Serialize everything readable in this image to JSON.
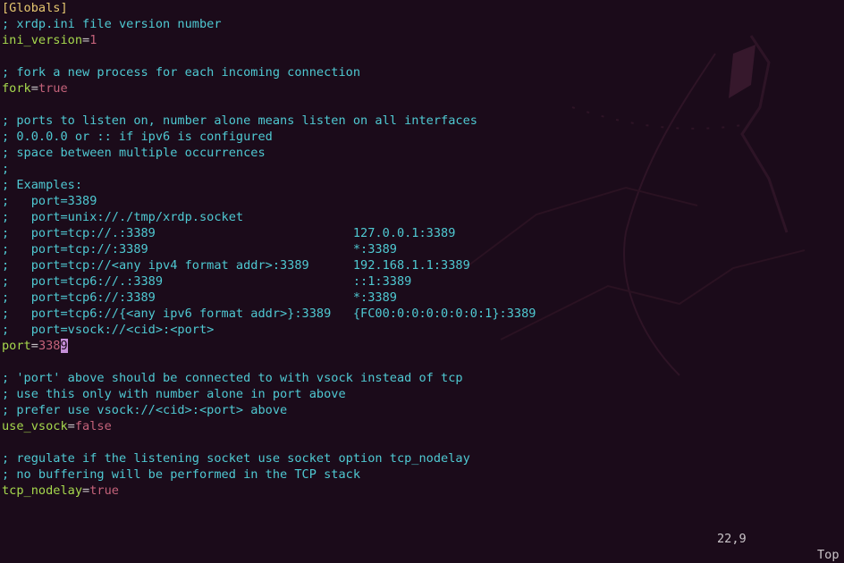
{
  "editor": {
    "lines": [
      {
        "t": "sec",
        "text": "[Globals]"
      },
      {
        "t": "cmt",
        "text": "; xrdp.ini file version number"
      },
      {
        "t": "kv",
        "key": "ini_version",
        "val": "1"
      },
      {
        "t": "blank",
        "text": ""
      },
      {
        "t": "cmt",
        "text": "; fork a new process for each incoming connection"
      },
      {
        "t": "kv",
        "key": "fork",
        "val": "true"
      },
      {
        "t": "blank",
        "text": ""
      },
      {
        "t": "cmt",
        "text": "; ports to listen on, number alone means listen on all interfaces"
      },
      {
        "t": "cmt",
        "text": "; 0.0.0.0 or :: if ipv6 is configured"
      },
      {
        "t": "cmt",
        "text": "; space between multiple occurrences"
      },
      {
        "t": "cmt",
        "text": ";"
      },
      {
        "t": "cmt",
        "text": "; Examples:"
      },
      {
        "t": "cmt",
        "text": ";   port=3389"
      },
      {
        "t": "cmt",
        "text": ";   port=unix://./tmp/xrdp.socket"
      },
      {
        "t": "cmt",
        "text": ";   port=tcp://.:3389                           127.0.0.1:3389"
      },
      {
        "t": "cmt",
        "text": ";   port=tcp://:3389                            *:3389"
      },
      {
        "t": "cmt",
        "text": ";   port=tcp://<any ipv4 format addr>:3389      192.168.1.1:3389"
      },
      {
        "t": "cmt",
        "text": ";   port=tcp6://.:3389                          ::1:3389"
      },
      {
        "t": "cmt",
        "text": ";   port=tcp6://:3389                           *:3389"
      },
      {
        "t": "cmt",
        "text": ";   port=tcp6://{<any ipv6 format addr>}:3389   {FC00:0:0:0:0:0:0:1}:3389"
      },
      {
        "t": "cmt",
        "text": ";   port=vsock://<cid>:<port>"
      },
      {
        "t": "kvc",
        "key": "port",
        "val_pre": "338",
        "cursor": "9",
        "val_post": ""
      },
      {
        "t": "blank",
        "text": ""
      },
      {
        "t": "cmt",
        "text": "; 'port' above should be connected to with vsock instead of tcp"
      },
      {
        "t": "cmt",
        "text": "; use this only with number alone in port above"
      },
      {
        "t": "cmt",
        "text": "; prefer use vsock://<cid>:<port> above"
      },
      {
        "t": "kv",
        "key": "use_vsock",
        "val": "false"
      },
      {
        "t": "blank",
        "text": ""
      },
      {
        "t": "cmt",
        "text": "; regulate if the listening socket use socket option tcp_nodelay"
      },
      {
        "t": "cmt",
        "text": "; no buffering will be performed in the TCP stack"
      },
      {
        "t": "kv",
        "key": "tcp_nodelay",
        "val": "true"
      }
    ]
  },
  "status": {
    "position": "22,9",
    "scroll": "Top"
  }
}
